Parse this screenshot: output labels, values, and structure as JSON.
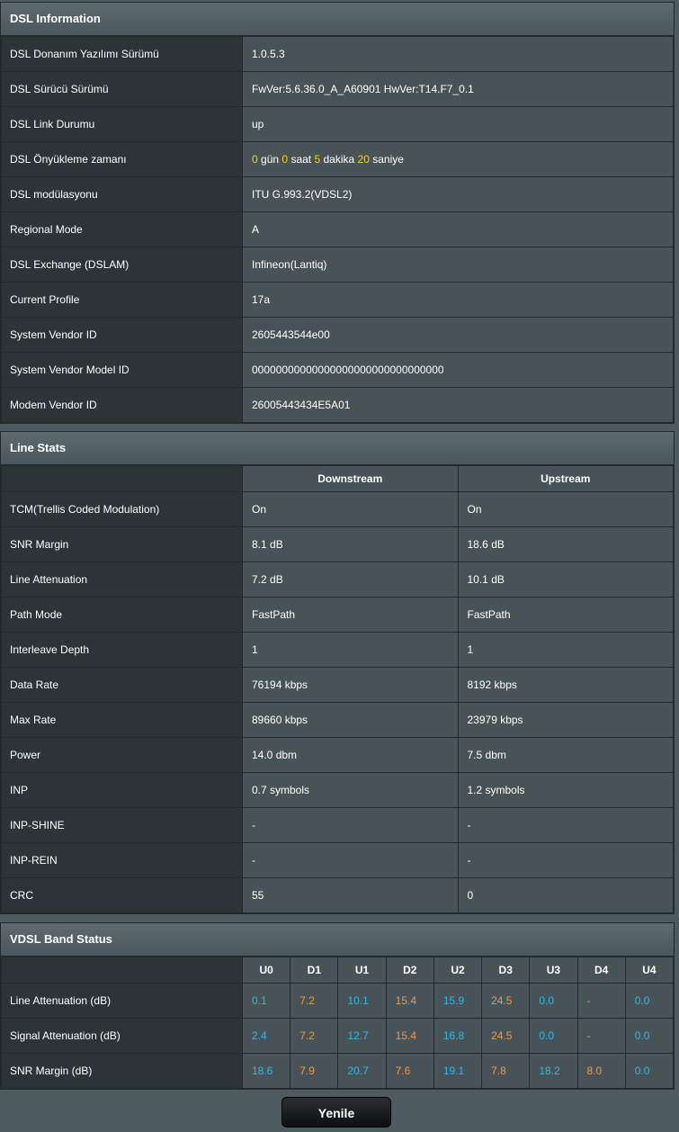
{
  "dsl_info": {
    "title": "DSL Information",
    "rows": [
      {
        "label": "DSL Donanım Yazılımı Sürümü",
        "value": "1.0.5.3"
      },
      {
        "label": "DSL Sürücü Sürümü",
        "value": "FwVer:5.6.36.0_A_A60901 HwVer:T14.F7_0.1"
      },
      {
        "label": "DSL Link Durumu",
        "value": "up"
      },
      {
        "label": "DSL Önyükleme zamanı",
        "value": ""
      },
      {
        "label": "DSL modülasyonu",
        "value": "ITU G.993.2(VDSL2)"
      },
      {
        "label": "Regional Mode",
        "value": "A"
      },
      {
        "label": "DSL Exchange (DSLAM)",
        "value": "Infineon(Lantiq)"
      },
      {
        "label": "Current Profile",
        "value": "17a"
      },
      {
        "label": "System Vendor ID",
        "value": "2605443544e00"
      },
      {
        "label": "System Vendor Model ID",
        "value": "00000000000000000000000000000000"
      },
      {
        "label": "Modem Vendor ID",
        "value": "26005443434E5A01"
      }
    ],
    "uptime": {
      "days": "0",
      "days_unit": "gün",
      "hours": "0",
      "hours_unit": "saat",
      "minutes": "5",
      "minutes_unit": "dakika",
      "seconds": "20",
      "seconds_unit": "saniye"
    }
  },
  "line_stats": {
    "title": "Line Stats",
    "col_down": "Downstream",
    "col_up": "Upstream",
    "rows": [
      {
        "label": "TCM(Trellis Coded Modulation)",
        "down": "On",
        "up": "On"
      },
      {
        "label": "SNR Margin",
        "down": "8.1 dB",
        "up": "18.6 dB"
      },
      {
        "label": "Line Attenuation",
        "down": "7.2 dB",
        "up": "10.1 dB"
      },
      {
        "label": "Path Mode",
        "down": "FastPath",
        "up": "FastPath"
      },
      {
        "label": "Interleave Depth",
        "down": "1",
        "up": "1"
      },
      {
        "label": "Data Rate",
        "down": "76194 kbps",
        "up": "8192 kbps"
      },
      {
        "label": "Max Rate",
        "down": "89660 kbps",
        "up": "23979 kbps"
      },
      {
        "label": "Power",
        "down": "14.0 dbm",
        "up": "7.5 dbm"
      },
      {
        "label": "INP",
        "down": "0.7 symbols",
        "up": "1.2 symbols"
      },
      {
        "label": "INP-SHINE",
        "down": "-",
        "up": "-"
      },
      {
        "label": "INP-REIN",
        "down": "-",
        "up": "-"
      },
      {
        "label": "CRC",
        "down": "55",
        "up": "0"
      }
    ]
  },
  "band_status": {
    "title": "VDSL Band Status",
    "bands": [
      "U0",
      "D1",
      "U1",
      "D2",
      "U2",
      "D3",
      "U3",
      "D4",
      "U4"
    ],
    "rows": [
      {
        "label": "Line Attenuation (dB)",
        "values": [
          "0.1",
          "7.2",
          "10.1",
          "15.4",
          "15.9",
          "24.5",
          "0.0",
          "-",
          "0.0"
        ]
      },
      {
        "label": "Signal Attenuation (dB)",
        "values": [
          "2.4",
          "7.2",
          "12.7",
          "15.4",
          "16.8",
          "24.5",
          "0.0",
          "-",
          "0.0"
        ]
      },
      {
        "label": "SNR Margin (dB)",
        "values": [
          "18.6",
          "7.9",
          "20.7",
          "7.6",
          "19.1",
          "7.8",
          "18.2",
          "8.0",
          "0.0"
        ]
      }
    ],
    "colors": {
      "upstream": "#31b6ea",
      "downstream": "#f5963a"
    }
  },
  "refresh_button": "Yenile",
  "colors": {
    "highlight": "#ffcc00",
    "label_bg": "#2b3538",
    "value_bg": "#475357"
  }
}
